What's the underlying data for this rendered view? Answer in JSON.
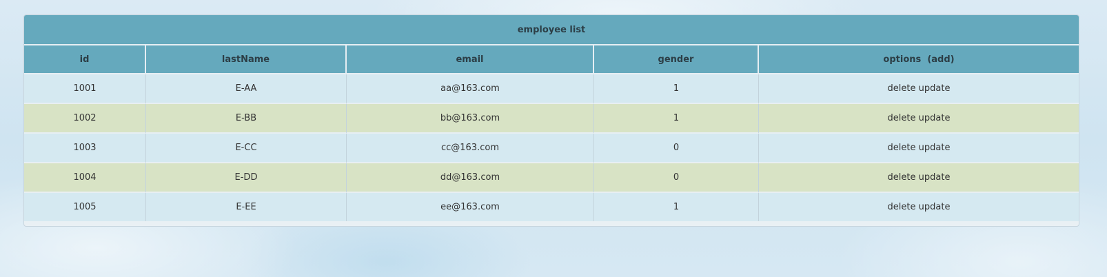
{
  "table": {
    "caption": "employee list",
    "headers": {
      "id": "id",
      "lastName": "lastName",
      "email": "email",
      "gender": "gender",
      "options_prefix": "options",
      "options_add": "(add)"
    },
    "rows": [
      {
        "id": "1001",
        "lastName": "E-AA",
        "email": "aa@163.com",
        "gender": "1",
        "delete": "delete",
        "update": "update"
      },
      {
        "id": "1002",
        "lastName": "E-BB",
        "email": "bb@163.com",
        "gender": "1",
        "delete": "delete",
        "update": "update"
      },
      {
        "id": "1003",
        "lastName": "E-CC",
        "email": "cc@163.com",
        "gender": "0",
        "delete": "delete",
        "update": "update"
      },
      {
        "id": "1004",
        "lastName": "E-DD",
        "email": "dd@163.com",
        "gender": "0",
        "delete": "delete",
        "update": "update"
      },
      {
        "id": "1005",
        "lastName": "E-EE",
        "email": "ee@163.com",
        "gender": "1",
        "delete": "delete",
        "update": "update"
      }
    ]
  },
  "colors": {
    "header_bg": "#65a9bd",
    "row_blue": "#d5e9f1",
    "row_green": "#d8e3c5"
  }
}
